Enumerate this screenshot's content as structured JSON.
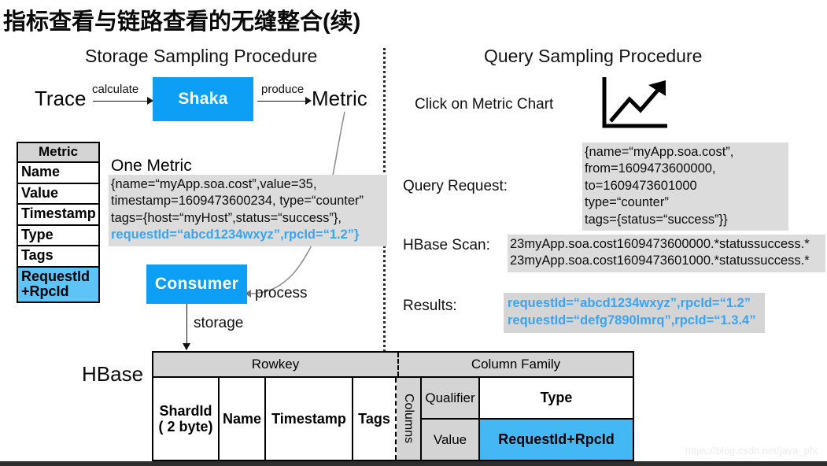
{
  "title": "指标查看与链路查看的无缝整合(续)",
  "left_panel": {
    "heading": "Storage Sampling Procedure",
    "trace_label": "Trace",
    "calculate_label": "calculate",
    "shaka_box": "Shaka",
    "produce_label": "produce",
    "metric_label": "Metric",
    "metric_schema": {
      "header": "Metric",
      "rows": [
        "Name",
        "Value",
        "Timestamp",
        "Type",
        "Tags"
      ],
      "highlight_row_line1": "RequestId",
      "highlight_row_line2": "+RpcId"
    },
    "one_metric_label": "One Metric",
    "one_metric_body": "{name=“myApp.soa.cost”,value=35,\ntimestamp=1609473600234, type=“counter”\ntags={host=“myHost”,status=“success”},",
    "one_metric_blue_line": "requestId=“abcd1234wxyz”,rpcId=“1.2”}",
    "consumer_box": "Consumer",
    "process_label": "process",
    "storage_label": "storage",
    "hbase_label": "HBase"
  },
  "right_panel": {
    "heading": "Query Sampling Procedure",
    "click_label": "Click on Metric Chart",
    "chart_icon": "line-chart-up-icon",
    "query_request_label": "Query Request:",
    "query_request_body": "{name=“myApp.soa.cost”,\nfrom=1609473600000,\nto=1609473601000\ntype=“counter”\ntags={status=“success”}}",
    "hbase_scan_label": "HBase Scan:",
    "hbase_scan_body": "23myApp.soa.cost1609473600000.*statussuccess.*\n23myApp.soa.cost1609473601000.*statussuccess.*",
    "results_label": "Results:",
    "results_body": "requestId=“abcd1234wxyz”,rpcId=“1.2”\nrequestId=“defg7890lmrq”,rpcId=“1.3.4”"
  },
  "hbase_table": {
    "group_rowkey": "Rowkey",
    "group_column_family": "Column Family",
    "rowkey_cells": [
      "ShardId\n( 2 byte)",
      "Name",
      "Timestamp",
      "Tags"
    ],
    "columns_label": "Columns",
    "qualifier_label": "Qualifier",
    "value_label": "Value",
    "type_cell": "Type",
    "requestid_cell": "RequestId+RpcId"
  },
  "watermark": "https://blog.csdn.net/java_pfx",
  "colors": {
    "accent_blue": "#0d9ef5",
    "light_blue": "#5ec3f7",
    "code_gray": "#dcdcdc",
    "table_gray": "#d4d4d4"
  }
}
